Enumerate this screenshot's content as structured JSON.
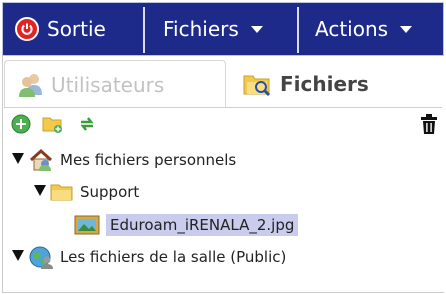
{
  "toolbar": {
    "exit_label": "Sortie",
    "files_menu_label": "Fichiers",
    "actions_menu_label": "Actions"
  },
  "tabs": [
    {
      "label": "Utilisateurs",
      "active": false
    },
    {
      "label": "Fichiers",
      "active": true
    }
  ],
  "icon_toolbar": {
    "icons": [
      "add-icon",
      "new-folder-icon",
      "refresh-icon",
      "trash-icon"
    ]
  },
  "tree": {
    "personal_label": "Mes fichiers personnels",
    "support_label": "Support",
    "file_label": "Eduroam_iRENALA_2.jpg",
    "public_label": "Les fichiers de la salle (Public)"
  },
  "colors": {
    "toolbar_bg": "#1e2a8a",
    "selection_bg": "#c9ccec",
    "power_red": "#e32226"
  }
}
